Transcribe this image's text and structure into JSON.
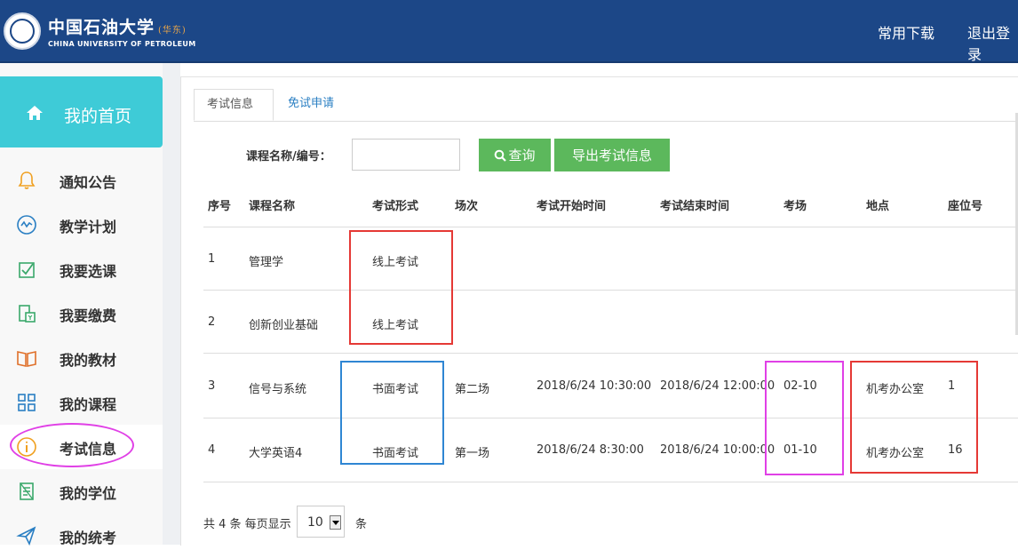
{
  "header": {
    "logo_cn": "中国石油大学",
    "logo_cn_suffix": "(华东)",
    "logo_en": "CHINA UNIVERSITY OF PETROLEUM",
    "downloads": "常用下载",
    "logout": "退出登录"
  },
  "sidebar": {
    "home": "我的首页",
    "items": [
      {
        "label": "通知公告",
        "icon": "bell-icon"
      },
      {
        "label": "教学计划",
        "icon": "wave-icon"
      },
      {
        "label": "我要选课",
        "icon": "checkbox-icon"
      },
      {
        "label": "我要缴费",
        "icon": "payment-icon"
      },
      {
        "label": "我的教材",
        "icon": "book-icon"
      },
      {
        "label": "我的课程",
        "icon": "grid-icon"
      },
      {
        "label": "考试信息",
        "icon": "info-icon"
      },
      {
        "label": "我的学位",
        "icon": "degree-icon"
      },
      {
        "label": "我的统考",
        "icon": "send-icon"
      }
    ]
  },
  "tabs": [
    "考试信息",
    "免试申请"
  ],
  "search": {
    "label": "课程名称/编号：",
    "query_button": "查询",
    "export_button": "导出考试信息"
  },
  "table": {
    "headers": [
      "序号",
      "课程名称",
      "考试形式",
      "场次",
      "考试开始时间",
      "考试结束时间",
      "考场",
      "地点",
      "座位号"
    ],
    "rows": [
      [
        "1",
        "管理学",
        "线上考试",
        "",
        "",
        "",
        "",
        "",
        ""
      ],
      [
        "2",
        "创新创业基础",
        "线上考试",
        "",
        "",
        "",
        "",
        "",
        ""
      ],
      [
        "3",
        "信号与系统",
        "书面考试",
        "第二场",
        "2018/6/24 10:30:00",
        "2018/6/24 12:00:00",
        "02-10",
        "机考办公室",
        "1"
      ],
      [
        "4",
        "大学英语4",
        "书面考试",
        "第一场",
        "2018/6/24 8:30:00",
        "2018/6/24 10:00:00",
        "01-10",
        "机考办公室",
        "16"
      ]
    ]
  },
  "footer": {
    "prefix": "共 4 条 每页显示",
    "page_size": "10",
    "suffix": "条"
  },
  "colors": {
    "header_bg": "#1c4787",
    "home_bg": "#3ecbd7",
    "button_green": "#5cb85c",
    "annotation_red": "#e53935",
    "annotation_blue": "#2f86d3",
    "annotation_magenta": "#e040e6"
  }
}
